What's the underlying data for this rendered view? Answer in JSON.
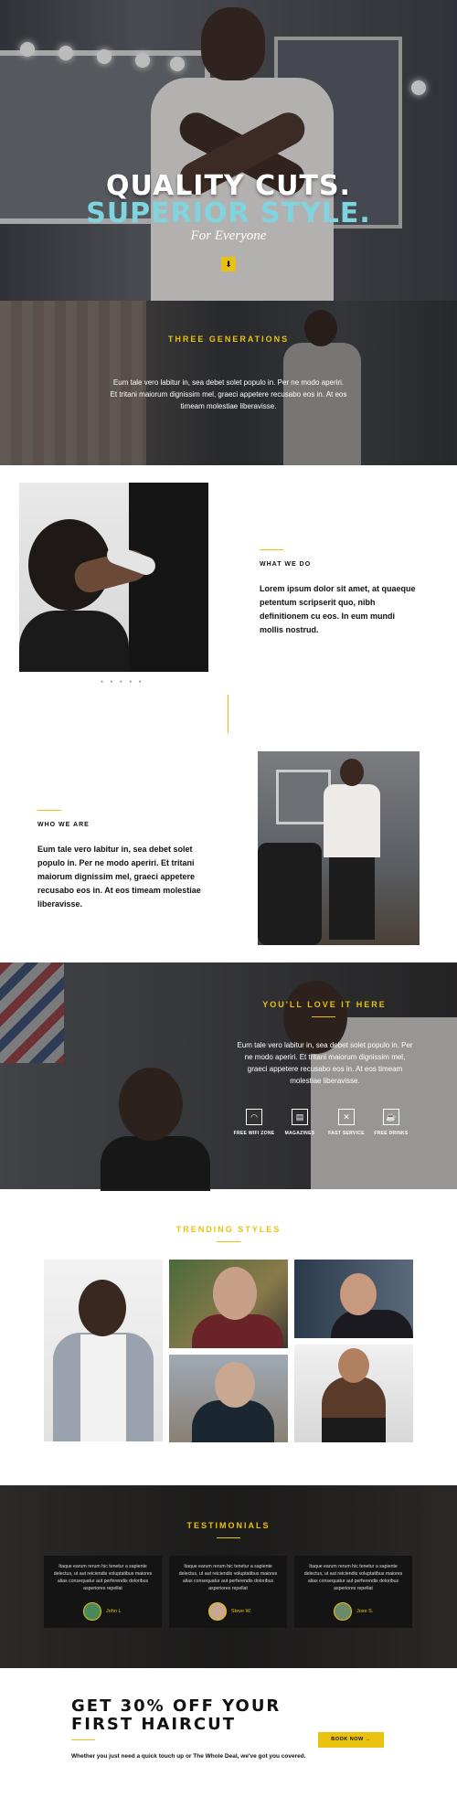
{
  "hero": {
    "title_line1": "QUALITY CUTS.",
    "title_line2": "SUPERIOR STYLE.",
    "subtitle": "For Everyone",
    "scroll_icon": "chevron-down-icon",
    "scroll_glyph": "⬇"
  },
  "generations": {
    "title": "THREE GENERATIONS",
    "text": "Eum tale vero labitur in, sea debet solet populo in. Per ne modo aperiri. Et tritani maiorum dignissim mel, graeci appetere recusabo eos in. At eos timeam molestiae liberavisse."
  },
  "what_we_do": {
    "kicker": "WHAT WE DO",
    "body": "Lorem ipsum dolor sit amet, at quaeque petentum scripserit quo, nibh definitionem cu eos. In eum mundi mollis nostrud.",
    "slider_dots": "● ● ● ● ●"
  },
  "who_we_are": {
    "kicker": "WHO WE ARE",
    "body": "Eum tale vero labitur in, sea debet solet populo in. Per ne modo aperiri. Et tritani maiorum dignissim mel, graeci appetere recusabo eos in. At eos timeam molestiae liberavisse."
  },
  "love": {
    "title": "YOU'LL LOVE IT HERE",
    "text": "Eum tale vero labitur in, sea debet solet populo in. Per ne modo aperiri. Et tritani maiorum dignissim mel, graeci appetere recusabo eos in. At eos timeam molestiae liberavisse.",
    "features": [
      {
        "label": "FREE WIFI ZONE",
        "icon": "wifi-icon",
        "glyph": "◠"
      },
      {
        "label": "MAGAZINES",
        "icon": "magazine-icon",
        "glyph": "▤"
      },
      {
        "label": "FAST SERVICE",
        "icon": "fast-service-icon",
        "glyph": "✕"
      },
      {
        "label": "FREE DRINKS",
        "icon": "drink-icon",
        "glyph": "☕"
      }
    ]
  },
  "trending": {
    "title": "TRENDING STYLES"
  },
  "testimonials": {
    "title": "TESTIMONIALS",
    "cards": [
      {
        "quote": "Itaque earum rerum hic tenetur a sapiente delectus, ut aut reiciendis voluptatibus maiores alias consequatur aut perferendis doloribus asperiores repellat",
        "name": "John L"
      },
      {
        "quote": "Itaque earum rerum hic tenetur a sapiente delectus, ut aut reiciendis voluptatibus maiores alias consequatur aut perferendis doloribus asperiores repellat",
        "name": "Steve W."
      },
      {
        "quote": "Itaque earum rerum hic tenetur a sapiente delectus, ut aut reiciendis voluptatibus maiores alias consequatur aut perferendis doloribus asperiores repellat",
        "name": "Jose S."
      }
    ]
  },
  "offer": {
    "title": "GET 30% OFF YOUR FIRST HAIRCUT",
    "subtitle": "Whether you just need a quick touch up or The Whole Deal, we've got you covered.",
    "button": "BOOK NOW →"
  },
  "colors": {
    "accent": "#e8c20e",
    "hero_cyan": "#7fd4e0",
    "dark": "#141414"
  }
}
